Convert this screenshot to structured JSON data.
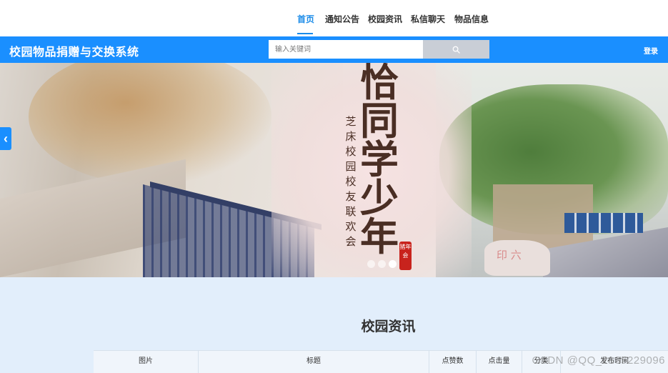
{
  "nav": {
    "items": [
      {
        "label": "首页",
        "active": true
      },
      {
        "label": "通知公告",
        "active": false
      },
      {
        "label": "校园资讯",
        "active": false
      },
      {
        "label": "私信聊天",
        "active": false
      },
      {
        "label": "物品信息",
        "active": false
      }
    ],
    "active_color": "#1a8be8"
  },
  "header": {
    "title": "校园物品捐赠与交换系统",
    "search_placeholder": "输入关键词",
    "search_icon": "search-icon",
    "login_label": "登录",
    "background_color": "#1a8fff"
  },
  "banner": {
    "calligraphy_main": [
      "恰",
      "同",
      "学",
      "少",
      "年"
    ],
    "calligraphy_subtitle": [
      "芝",
      "床",
      "校",
      "园",
      "校",
      "友",
      "联",
      "欢",
      "会"
    ],
    "seal_text": "猪年会",
    "stone_text": "印 六",
    "prev_icon": "chevron-left-icon",
    "slide_count": 3,
    "active_slide": 3
  },
  "news": {
    "title": "校园资讯",
    "columns": [
      "图片",
      "标题",
      "点赞数",
      "点击量",
      "分类",
      "发布时间"
    ]
  },
  "watermark": "CSDN @QQ_2135229096"
}
